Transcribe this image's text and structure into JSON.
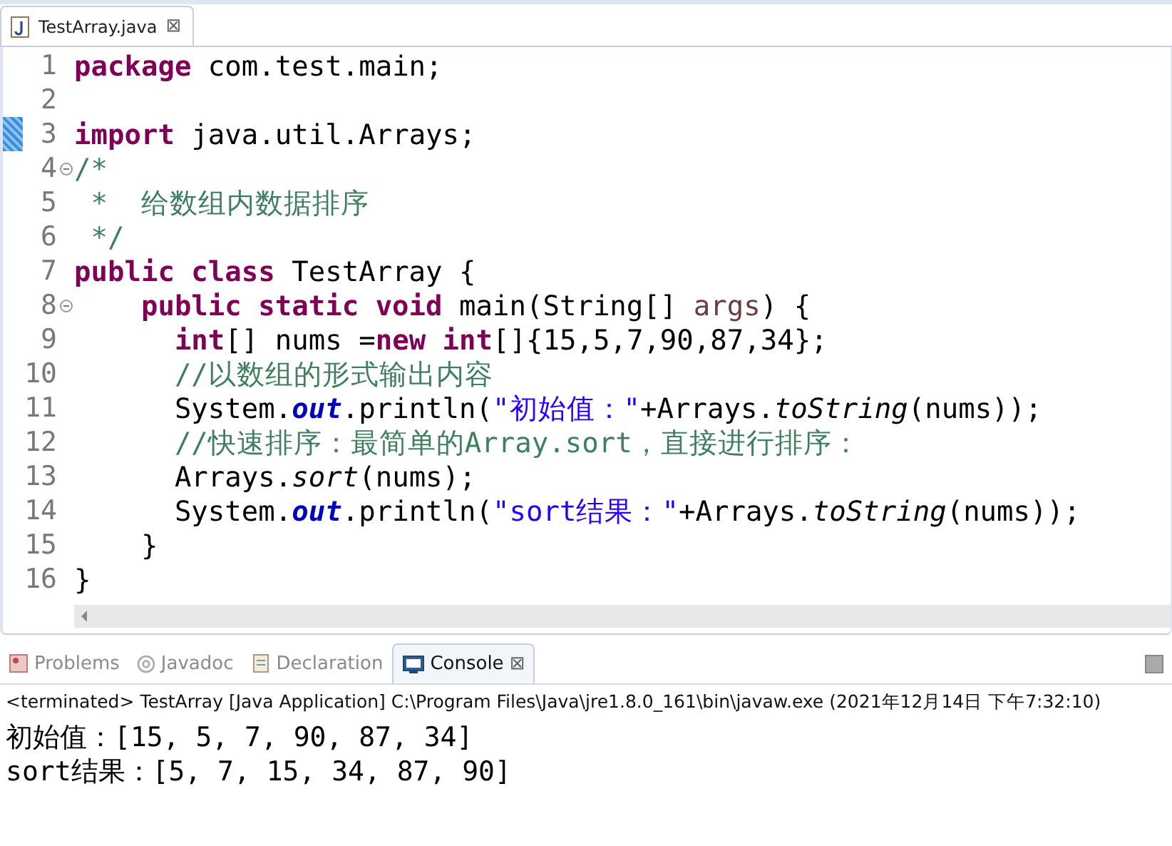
{
  "editor": {
    "tab": {
      "title": "TestArray.java",
      "close": "⊠"
    },
    "lines": [
      {
        "number": "1",
        "marked": false,
        "fold": false,
        "tokens": [
          {
            "kind": "keyword",
            "text": "package"
          },
          {
            "kind": "plain",
            "text": " com.test.main;"
          }
        ]
      },
      {
        "number": "2",
        "marked": false,
        "fold": false
      },
      {
        "number": "3",
        "marked": true,
        "fold": false,
        "tokens": [
          {
            "kind": "keyword",
            "text": "import"
          },
          {
            "kind": "plain",
            "text": " java.util.Arrays;"
          }
        ]
      },
      {
        "number": "4",
        "marked": false,
        "fold": true,
        "tokens": [
          {
            "kind": "comment",
            "text": "/*"
          }
        ]
      },
      {
        "number": "5",
        "marked": false,
        "fold": false,
        "tokens": [
          {
            "kind": "comment",
            "text": " *  给数组内数据排序"
          }
        ]
      },
      {
        "number": "6",
        "marked": false,
        "fold": false,
        "tokens": [
          {
            "kind": "comment",
            "text": " */"
          }
        ]
      },
      {
        "number": "7",
        "marked": false,
        "fold": false,
        "tokens": [
          {
            "kind": "keyword",
            "text": "public class"
          },
          {
            "kind": "plain",
            "text": " TestArray {"
          }
        ]
      },
      {
        "number": "8",
        "marked": false,
        "fold": true,
        "tokens": [
          {
            "kind": "keyword",
            "text": "    public static void"
          },
          {
            "kind": "plain",
            "text": " main(String[] "
          },
          {
            "kind": "param",
            "text": "args"
          },
          {
            "kind": "plain",
            "text": ") {"
          }
        ]
      },
      {
        "number": "9",
        "marked": false,
        "fold": false,
        "tokens": [
          {
            "kind": "keyword",
            "text": "      int"
          },
          {
            "kind": "plain",
            "text": "[] nums ="
          },
          {
            "kind": "keyword",
            "text": "new int"
          },
          {
            "kind": "plain",
            "text": "[]{15,5,7,90,87,34};"
          }
        ]
      },
      {
        "number": "10",
        "marked": false,
        "fold": false,
        "tokens": [
          {
            "kind": "comment",
            "text": "      //以数组的形式输出内容"
          }
        ]
      },
      {
        "number": "11",
        "marked": false,
        "fold": false,
        "tokens": [
          {
            "kind": "plain",
            "text": "      System."
          },
          {
            "kind": "field",
            "text": "out"
          },
          {
            "kind": "plain",
            "text": ".println("
          },
          {
            "kind": "string",
            "text": "\"初始值：\""
          },
          {
            "kind": "plain",
            "text": "+Arrays."
          },
          {
            "kind": "static",
            "text": "toString"
          },
          {
            "kind": "plain",
            "text": "(nums));"
          }
        ]
      },
      {
        "number": "12",
        "marked": false,
        "fold": false,
        "tokens": [
          {
            "kind": "comment",
            "text": "      //快速排序：最简单的Array.sort，直接进行排序："
          }
        ]
      },
      {
        "number": "13",
        "marked": false,
        "fold": false,
        "tokens": [
          {
            "kind": "plain",
            "text": "      Arrays."
          },
          {
            "kind": "static",
            "text": "sort"
          },
          {
            "kind": "plain",
            "text": "(nums);"
          }
        ]
      },
      {
        "number": "14",
        "marked": false,
        "fold": false,
        "tokens": [
          {
            "kind": "plain",
            "text": "      System."
          },
          {
            "kind": "field",
            "text": "out"
          },
          {
            "kind": "plain",
            "text": ".println("
          },
          {
            "kind": "string",
            "text": "\"sort结果：\""
          },
          {
            "kind": "plain",
            "text": "+Arrays."
          },
          {
            "kind": "static",
            "text": "toString"
          },
          {
            "kind": "plain",
            "text": "(nums));"
          }
        ]
      },
      {
        "number": "15",
        "marked": false,
        "fold": false,
        "tokens": [
          {
            "kind": "plain",
            "text": "    }"
          }
        ]
      },
      {
        "number": "16",
        "marked": false,
        "fold": false,
        "tokens": [
          {
            "kind": "plain",
            "text": "}"
          }
        ]
      }
    ]
  },
  "panel": {
    "tabs": [
      {
        "label": "Problems",
        "selected": false
      },
      {
        "label": "Javadoc",
        "selected": false
      },
      {
        "label": "Declaration",
        "selected": false
      },
      {
        "label": "Console",
        "selected": true,
        "close": "⊠"
      }
    ],
    "status": "<terminated> TestArray [Java Application] C:\\Program Files\\Java\\jre1.8.0_161\\bin\\javaw.exe (2021年12月14日 下午7:32:10)",
    "output": [
      "初始值：[15, 5, 7, 90, 87, 34]",
      "sort结果：[5, 7, 15, 34, 87, 90]"
    ]
  }
}
